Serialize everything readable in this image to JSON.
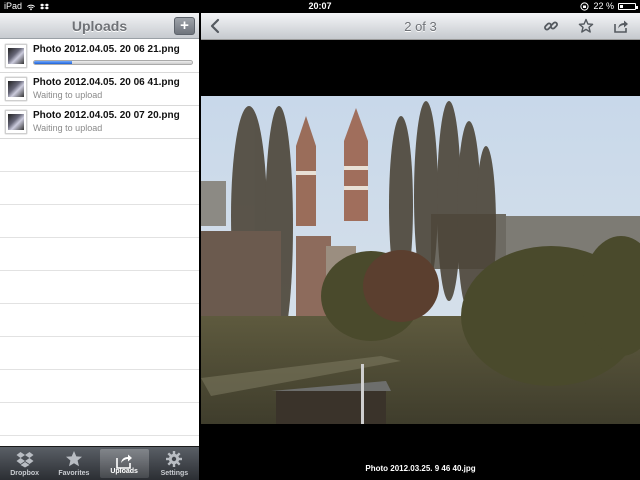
{
  "status_bar": {
    "device": "iPad",
    "time": "20:07",
    "battery": "22 %",
    "battery_level": 0.22
  },
  "left_pane": {
    "title": "Uploads",
    "add_label": "+",
    "uploads": [
      {
        "filename": "Photo 2012.04.05. 20 06 21.png",
        "status": "",
        "progress": 0.24
      },
      {
        "filename": "Photo 2012.04.05. 20 06 41.png",
        "status": "Waiting to upload"
      },
      {
        "filename": "Photo 2012.04.05. 20 07 20.png",
        "status": "Waiting to upload"
      }
    ]
  },
  "tab_bar": {
    "tabs": [
      {
        "label": "Dropbox",
        "icon": "dropbox-icon"
      },
      {
        "label": "Favorites",
        "icon": "star-icon"
      },
      {
        "label": "Uploads",
        "icon": "upload-icon",
        "active": true
      },
      {
        "label": "Settings",
        "icon": "gear-icon"
      }
    ]
  },
  "viewer": {
    "page_indicator": "2 of 3",
    "caption": "Photo 2012.03.25. 9 46 40.jpg",
    "icons": [
      "back-chevron-icon",
      "link-icon",
      "star-outline-icon",
      "share-icon"
    ]
  },
  "colors": {
    "progress": "#2a6fe0",
    "nav_text": "#6f7277"
  }
}
